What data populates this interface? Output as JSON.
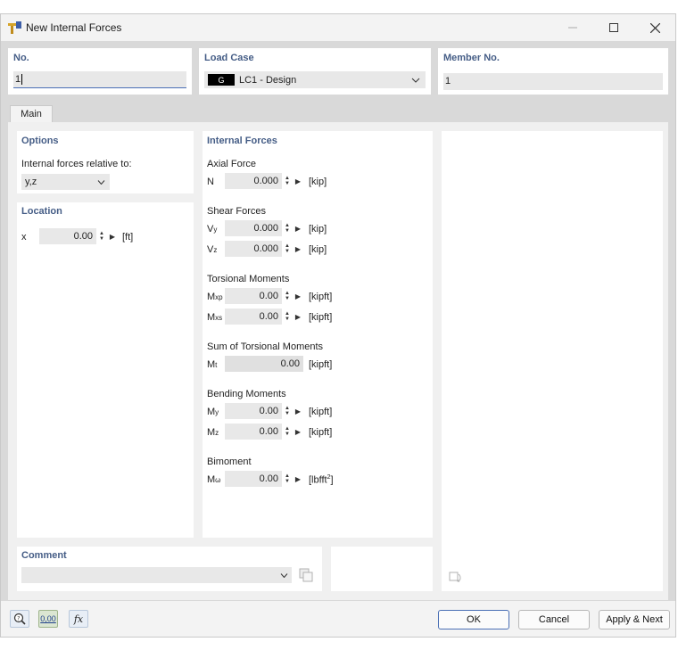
{
  "window": {
    "title": "New Internal Forces",
    "icon": "rfem-app-icon"
  },
  "top_fields": {
    "no": {
      "label": "No.",
      "value": "1"
    },
    "load_case": {
      "label": "Load Case",
      "badge": "G",
      "value": "LC1 - Design"
    },
    "member_no": {
      "label": "Member No.",
      "value": "1"
    }
  },
  "tabs": [
    {
      "label": "Main",
      "active": true
    }
  ],
  "options": {
    "title": "Options",
    "relative_label": "Internal forces relative to:",
    "relative_value": "y,z"
  },
  "location": {
    "title": "Location",
    "x": {
      "label": "x",
      "value": "0.00",
      "unit": "[ft]"
    }
  },
  "internal_forces": {
    "title": "Internal Forces",
    "axial": {
      "heading": "Axial Force",
      "n": {
        "label": "N",
        "value": "0.000",
        "unit": "[kip]"
      }
    },
    "shear": {
      "heading": "Shear Forces",
      "vy": {
        "label": "V",
        "sub": "y",
        "value": "0.000",
        "unit": "[kip]"
      },
      "vz": {
        "label": "V",
        "sub": "z",
        "value": "0.000",
        "unit": "[kip]"
      }
    },
    "torsion": {
      "heading": "Torsional Moments",
      "mxp": {
        "label": "M",
        "sub": "xp",
        "value": "0.00",
        "unit": "[kipft]"
      },
      "mxs": {
        "label": "M",
        "sub": "xs",
        "value": "0.00",
        "unit": "[kipft]"
      }
    },
    "sum_torsion": {
      "heading": "Sum of Torsional Moments",
      "mt": {
        "label": "M",
        "sub": "t",
        "value": "0.00",
        "unit": "[kipft]"
      }
    },
    "bending": {
      "heading": "Bending Moments",
      "my": {
        "label": "M",
        "sub": "y",
        "value": "0.00",
        "unit": "[kipft]"
      },
      "mz": {
        "label": "M",
        "sub": "z",
        "value": "0.00",
        "unit": "[kipft]"
      }
    },
    "bimoment": {
      "heading": "Bimoment",
      "mw": {
        "label": "M",
        "sub": "ω",
        "value": "0.00",
        "unit": "[lbfft",
        "unit_sup": "2",
        "unit_end": "]"
      }
    }
  },
  "comment": {
    "title": "Comment",
    "value": ""
  },
  "buttons": {
    "ok": "OK",
    "cancel": "Cancel",
    "apply_next": "Apply & Next"
  },
  "toolbar": {
    "units_label": "0,00",
    "function_label": "fx"
  }
}
